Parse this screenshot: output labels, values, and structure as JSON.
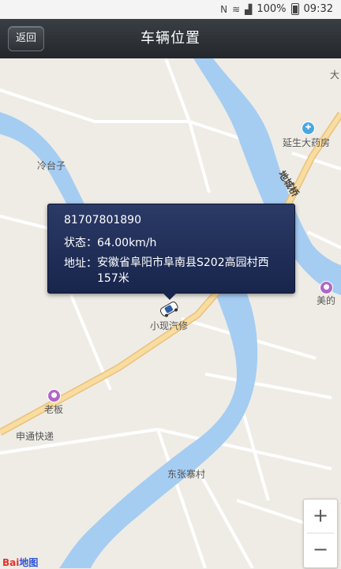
{
  "status_bar": {
    "nfc": "N",
    "battery": "100%",
    "time": "09:32"
  },
  "header": {
    "back_label": "返回",
    "title": "车辆位置"
  },
  "popup": {
    "vehicle_id": "81707801890",
    "status_label": "状态：",
    "status_value": "64.00km/h",
    "address_label": "地址：",
    "address_value": "安徽省阜阳市阜南县S202高园村西157米"
  },
  "map": {
    "labels": {
      "lengtaizi": "冷台子",
      "yansheng_pharmacy": "延生大药房",
      "da": "大",
      "xiaowang_auto": "小现汽修",
      "meide": "美的",
      "laoban": "老板",
      "shentong": "申通快递",
      "dongzhangzhai": "东张寨村",
      "road_bridge": "地城桥"
    },
    "colors": {
      "river": "#a5cdf2",
      "road_main": "#f8dca0",
      "road_minor": "#ffffff",
      "land": "#efece6"
    }
  },
  "zoom": {
    "in": "+",
    "out": "−"
  },
  "logo": {
    "text_red": "Bai",
    "text_blue": "地图"
  }
}
